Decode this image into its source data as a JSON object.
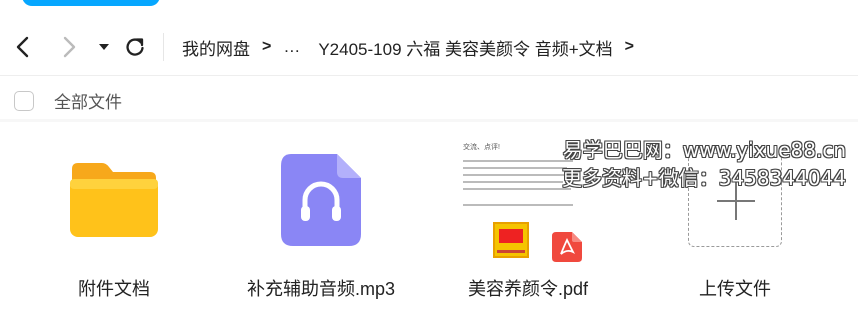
{
  "breadcrumb": {
    "items": [
      "我的网盘",
      "…",
      "Y2405-109 六福 美容美颜令 音频+文档"
    ]
  },
  "toolbar": {
    "select_all_label": "全部文件"
  },
  "files": [
    {
      "name": "附件文档",
      "type": "folder"
    },
    {
      "name": "补充辅助音频.mp3",
      "type": "audio"
    },
    {
      "name": "美容养颜令.pdf",
      "type": "pdf"
    },
    {
      "name": "上传文件",
      "type": "upload"
    }
  ],
  "pdf_preview": {
    "header_text": "交流、点评!"
  },
  "watermark": {
    "line1": "易学巴巴网：www.yixue88.cn",
    "line2": "更多资料+微信：3458344044"
  },
  "colors": {
    "accent": "#06a7ff",
    "folder_yellow": "#ffc21a",
    "audio_purple": "#8a86f5",
    "pdf_red": "#f0493e"
  }
}
